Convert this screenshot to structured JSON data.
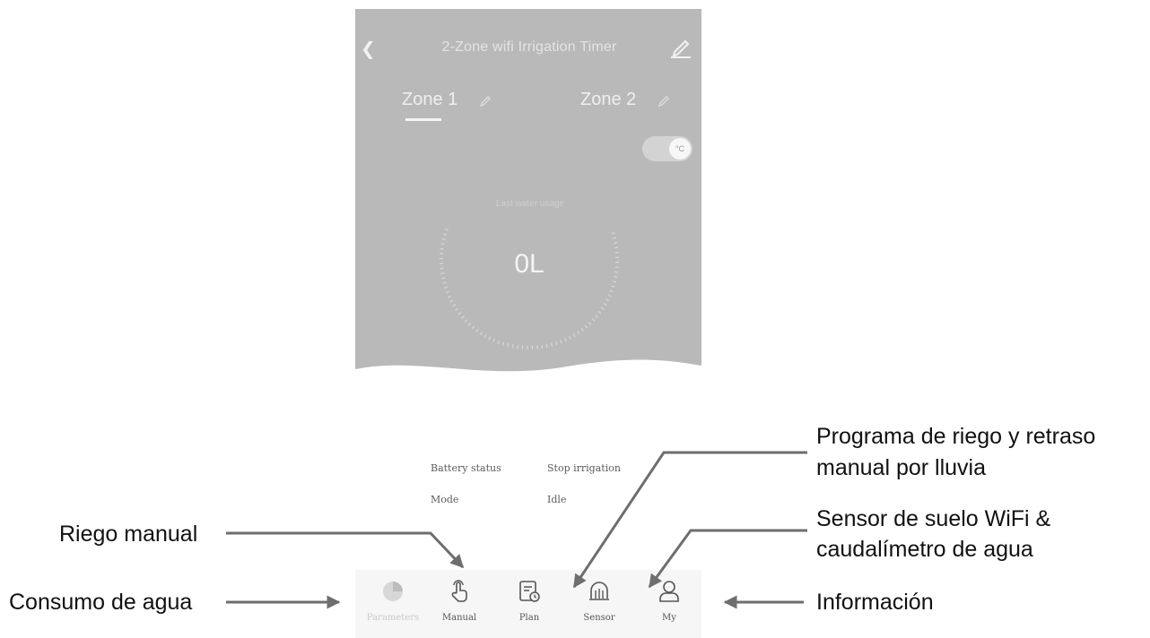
{
  "header": {
    "back_icon": "chevron-left-icon",
    "title": "2-Zone wifi Irrigation Timer",
    "edit_icon": "pencil-icon"
  },
  "zones": [
    {
      "label": "Zone 1",
      "selected": true
    },
    {
      "label": "Zone 2",
      "selected": false
    }
  ],
  "unit_toggle": {
    "label": "°C"
  },
  "usage": {
    "label": "Last water usage",
    "value": "0L"
  },
  "status": {
    "battery_label": "Battery status",
    "battery_value": "Stop irrigation",
    "mode_label": "Mode",
    "mode_value": "Idle"
  },
  "tabs": [
    {
      "label": "Parameters",
      "icon": "pie-chart-icon"
    },
    {
      "label": "Manual",
      "icon": "hand-tap-icon"
    },
    {
      "label": "Plan",
      "icon": "schedule-icon"
    },
    {
      "label": "Sensor",
      "icon": "sensor-icon"
    },
    {
      "label": "My",
      "icon": "user-icon"
    }
  ],
  "annotations": {
    "plan_line1": "Programa de riego y retraso",
    "plan_line2": "manual por lluvia",
    "sensor_line1": "Sensor de suelo WiFi &",
    "sensor_line2": "caudalímetro de agua",
    "manual": "Riego manual",
    "consumption": "Consumo de agua",
    "info": "Información"
  },
  "colors": {
    "panel_gray": "#b9b9b9",
    "tabbar_bg": "#f6f6f6",
    "arrow_gray": "#6e6e6e"
  }
}
